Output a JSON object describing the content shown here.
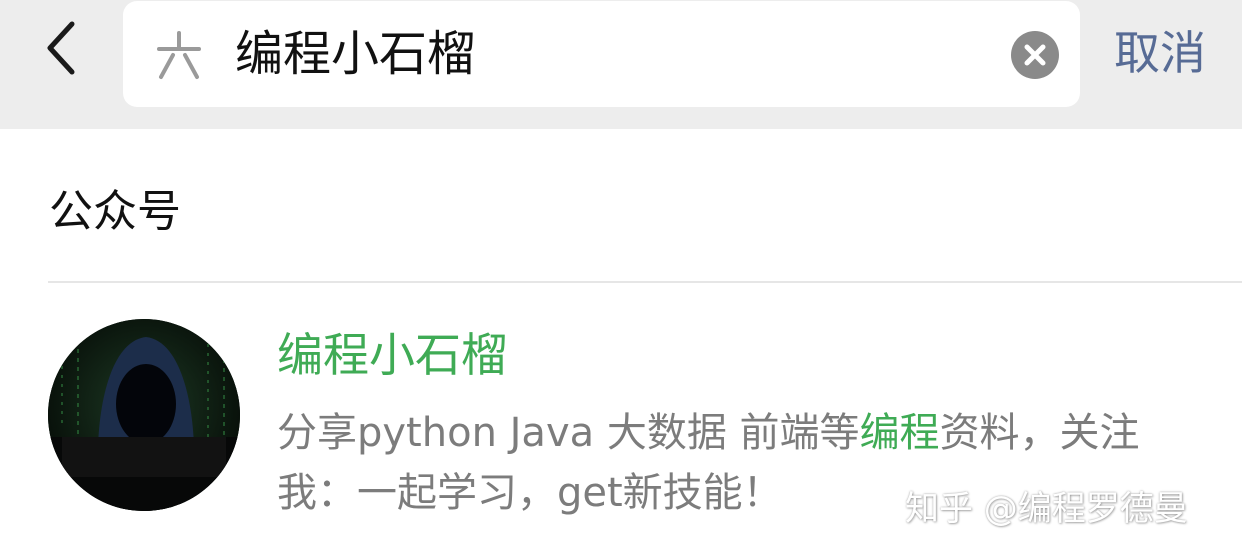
{
  "search": {
    "query": "编程小石榴",
    "cancel_label": "取消"
  },
  "section": {
    "title": "公众号"
  },
  "result": {
    "name": "编程小石榴",
    "desc_before": "分享python Java 大数据 前端等",
    "desc_highlight": "编程",
    "desc_after": "资料，关注我：一起学习，get新技能！"
  },
  "watermark": "知乎 @编程罗德曼",
  "colors": {
    "topbar_bg": "#ededed",
    "highlight_green": "#3fab55",
    "cancel_blue": "#576b95",
    "desc_gray": "#7c7c7c"
  },
  "icons": {
    "back": "chevron-left-icon",
    "search": "wechat-search-icon",
    "clear": "clear-x-icon"
  }
}
